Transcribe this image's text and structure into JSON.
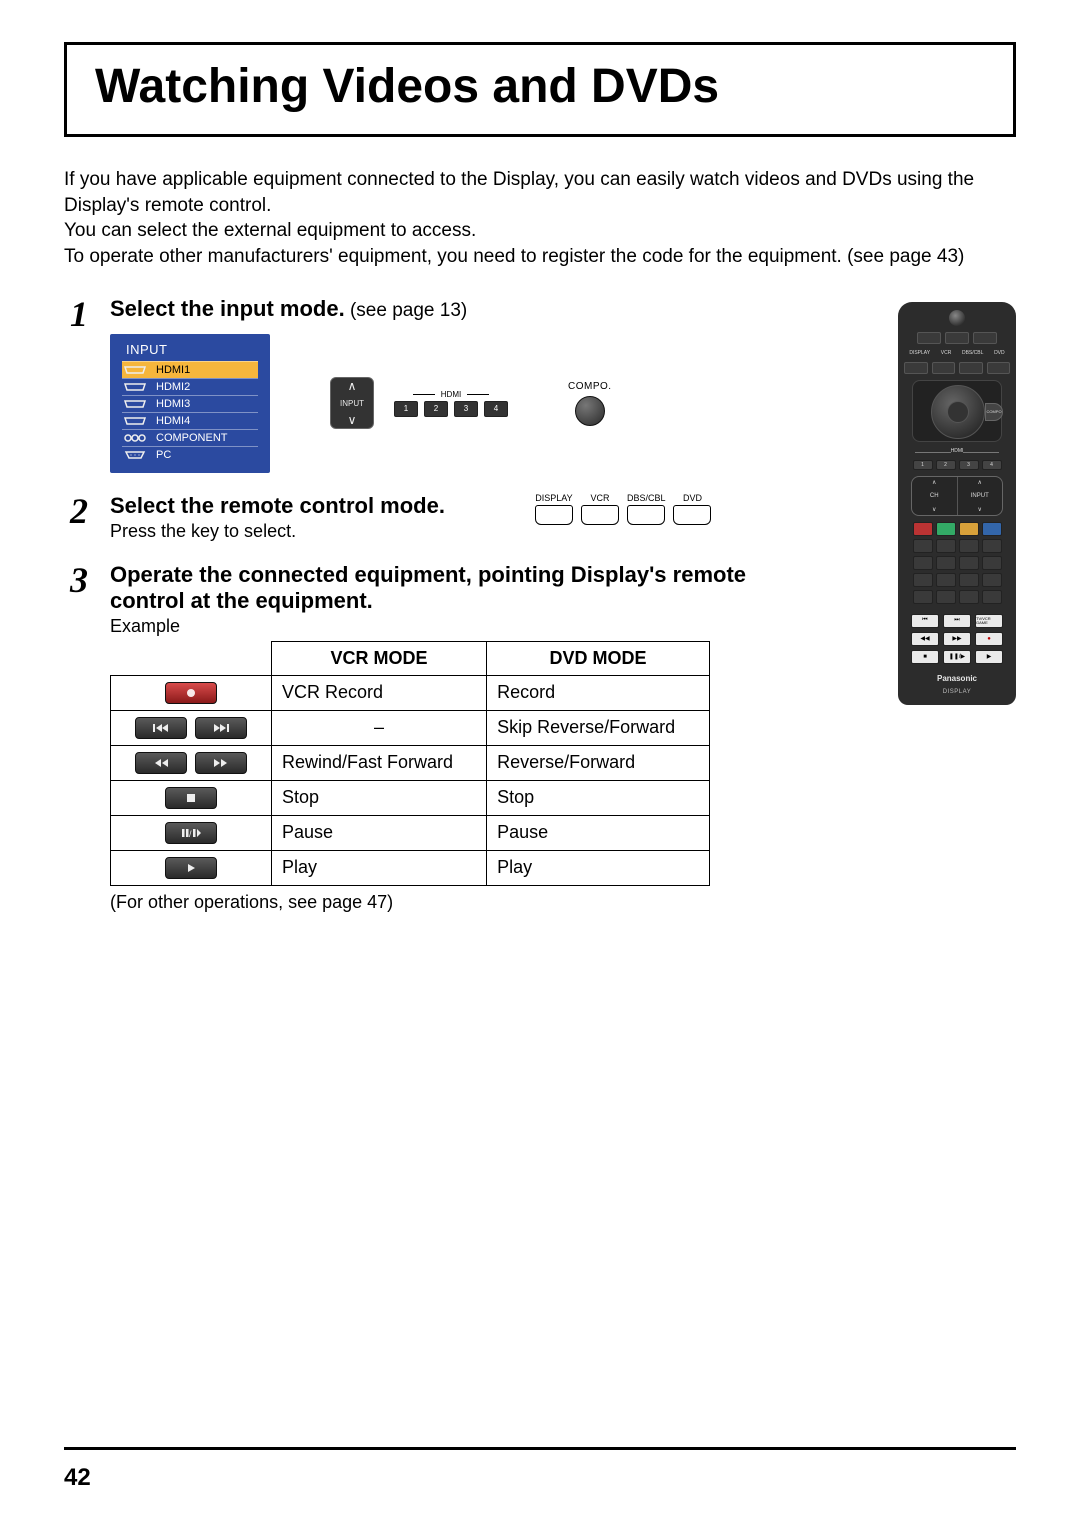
{
  "page_number": "42",
  "title": "Watching Videos and DVDs",
  "intro_lines": [
    "If you have applicable equipment connected to the Display, you can easily watch videos and DVDs using the Display's remote control.",
    "You can select the external equipment to access.",
    "To operate other manufacturers' equipment, you need to register the code for the equipment. (see page 43)"
  ],
  "steps": {
    "s1": {
      "num": "1",
      "head": "Select the input mode.",
      "ref": " (see page 13)",
      "osd_title": "INPUT",
      "osd_items": [
        "HDMI1",
        "HDMI2",
        "HDMI3",
        "HDMI4",
        "COMPONENT",
        "PC"
      ],
      "input_label": "INPUT",
      "hdmi_label": "HDMI",
      "hdmi_nums": [
        "1",
        "2",
        "3",
        "4"
      ],
      "compo_label": "COMPO."
    },
    "s2": {
      "num": "2",
      "head": "Select the remote control mode.",
      "sub": "Press the key to select.",
      "mode_keys": [
        "DISPLAY",
        "VCR",
        "DBS/CBL",
        "DVD"
      ]
    },
    "s3": {
      "num": "3",
      "head": "Operate the connected equipment, pointing Display's remote control at the equipment.",
      "example": "Example",
      "footnote": "(For other operations, see page 47)"
    }
  },
  "table": {
    "headers": [
      "VCR MODE",
      "DVD MODE"
    ],
    "rows": [
      {
        "btn": "record",
        "vcr": "VCR Record",
        "dvd": "Record"
      },
      {
        "btn": "skip-pair",
        "vcr": "–",
        "dvd": "Skip Reverse/Forward"
      },
      {
        "btn": "seek-pair",
        "vcr": "Rewind/Fast Forward",
        "dvd": "Reverse/Forward"
      },
      {
        "btn": "stop",
        "vcr": "Stop",
        "dvd": "Stop"
      },
      {
        "btn": "pause",
        "vcr": "Pause",
        "dvd": "Pause"
      },
      {
        "btn": "play",
        "vcr": "Play",
        "dvd": "Play"
      }
    ]
  },
  "remote": {
    "mode_keys": [
      "DISPLAY",
      "VCR",
      "DBS/CBL",
      "DVD"
    ],
    "hdmi_nums": [
      "1",
      "2",
      "3",
      "4"
    ],
    "hdmi_label": "HDMI",
    "compo": "COMPO",
    "ch": "CH",
    "input": "INPUT",
    "transport": [
      "⏮",
      "⏭",
      "TV/VCR GAME",
      "◀◀",
      "▶▶",
      "●",
      "■",
      "❚❚/▶",
      "▶"
    ],
    "brand": "Panasonic",
    "sub": "DISPLAY"
  }
}
